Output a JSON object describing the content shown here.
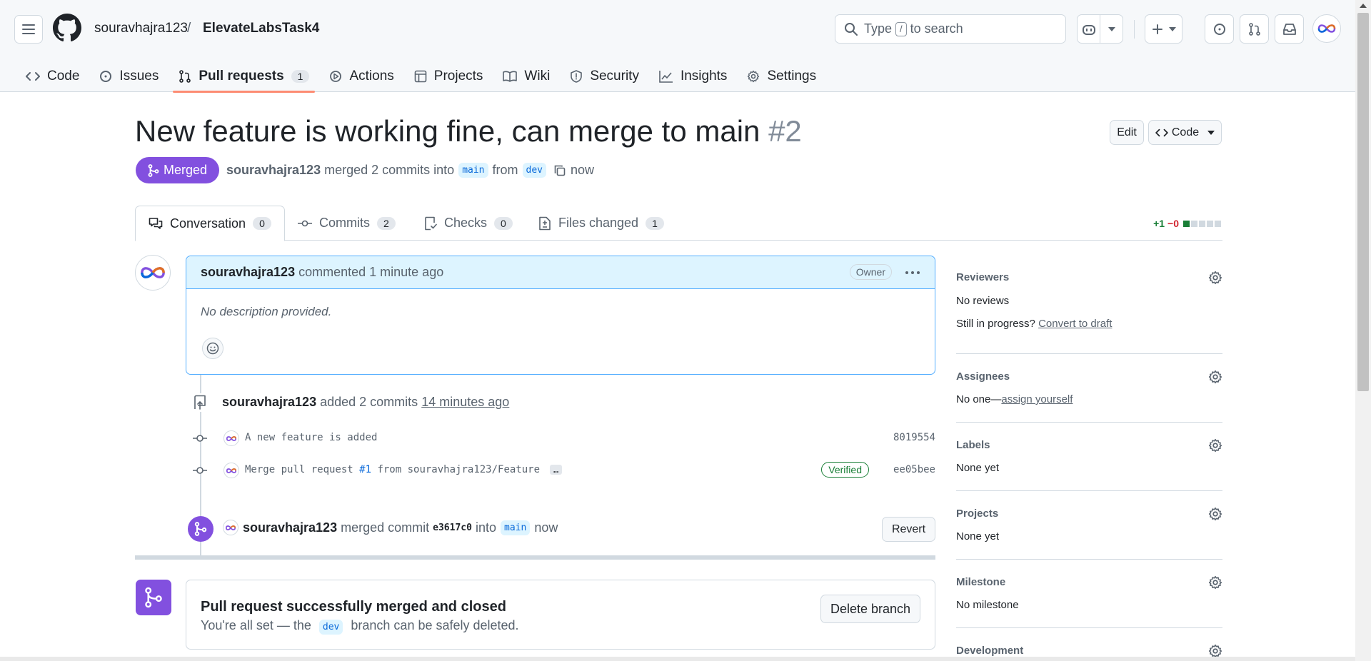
{
  "header": {
    "owner": "souravhajra123",
    "separator": "/",
    "repo": "ElevateLabsTask4",
    "search_prefix": "Type",
    "search_key": "/",
    "search_suffix": "to search"
  },
  "repo_tabs": [
    {
      "label": "Code",
      "icon": "code-icon"
    },
    {
      "label": "Issues",
      "icon": "issue-icon"
    },
    {
      "label": "Pull requests",
      "icon": "pull-request-icon",
      "count": "1",
      "active": true
    },
    {
      "label": "Actions",
      "icon": "play-icon"
    },
    {
      "label": "Projects",
      "icon": "table-icon"
    },
    {
      "label": "Wiki",
      "icon": "book-icon"
    },
    {
      "label": "Security",
      "icon": "shield-icon"
    },
    {
      "label": "Insights",
      "icon": "graph-icon"
    },
    {
      "label": "Settings",
      "icon": "gear-icon"
    }
  ],
  "pr": {
    "title": "New feature is working fine, can merge to main",
    "number": "#2",
    "edit_label": "Edit",
    "code_label": "Code",
    "state_label": "Merged",
    "author": "souravhajra123",
    "merged_text": "merged 2 commits into",
    "base_branch": "main",
    "from_text": "from",
    "head_branch": "dev",
    "time": "now"
  },
  "pr_tabs": {
    "conversation": {
      "label": "Conversation",
      "count": "0"
    },
    "commits": {
      "label": "Commits",
      "count": "2"
    },
    "checks": {
      "label": "Checks",
      "count": "0"
    },
    "files": {
      "label": "Files changed",
      "count": "1"
    },
    "diffstat_add": "+1",
    "diffstat_del": "−0"
  },
  "comment": {
    "author": "souravhajra123",
    "action": "commented 1 minute ago",
    "badge": "Owner",
    "body": "No description provided."
  },
  "commits_event": {
    "author": "souravhajra123",
    "text": "added 2 commits",
    "time": "14 minutes ago"
  },
  "commits": [
    {
      "message": "A new feature is added",
      "sha": "8019554"
    },
    {
      "message_prefix": "Merge pull request",
      "link": "#1",
      "message_suffix": "from souravhajra123/Feature",
      "more": "…",
      "verified": "Verified",
      "sha": "ee05bee"
    }
  ],
  "merge_event": {
    "author": "souravhajra123",
    "text": "merged commit",
    "sha": "e3617c0",
    "into": "into",
    "branch": "main",
    "time": "now",
    "revert_label": "Revert"
  },
  "merge_status": {
    "title": "Pull request successfully merged and closed",
    "sub_prefix": "You're all set — the",
    "branch": "dev",
    "sub_suffix": "branch can be safely deleted.",
    "delete_label": "Delete branch"
  },
  "sidebar": {
    "reviewers": {
      "title": "Reviewers",
      "value": "No reviews",
      "draft_prefix": "Still in progress?",
      "draft_link": "Convert to draft"
    },
    "assignees": {
      "title": "Assignees",
      "value_prefix": "No one—",
      "value_link": "assign yourself"
    },
    "labels": {
      "title": "Labels",
      "value": "None yet"
    },
    "projects": {
      "title": "Projects",
      "value": "None yet"
    },
    "milestone": {
      "title": "Milestone",
      "value": "No milestone"
    },
    "development": {
      "title": "Development"
    }
  },
  "colors": {
    "merged": "#8250df",
    "accent_tab": "#fd8c73",
    "link": "#0969da",
    "success": "#1a7f37",
    "danger": "#d1242f"
  }
}
